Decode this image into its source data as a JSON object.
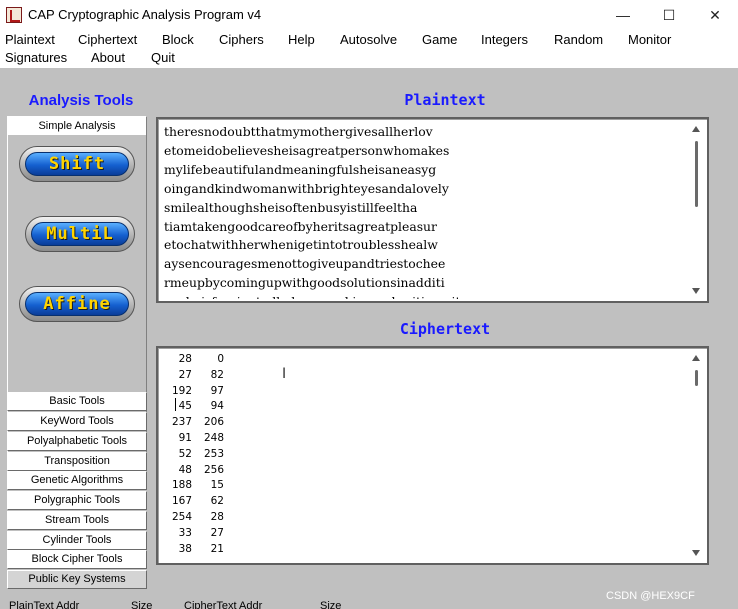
{
  "window": {
    "title": "CAP  Cryptographic Analysis Program v4",
    "minimize_icon": "minimize-icon",
    "maximize_icon": "maximize-icon",
    "close_icon": "close-icon"
  },
  "menu": {
    "items": [
      "Plaintext",
      "Ciphertext",
      "Block",
      "Ciphers",
      "Help",
      "Autosolve",
      "Game",
      "Integers",
      "Random",
      "Monitor",
      "Signatures",
      "About",
      "Quit"
    ]
  },
  "left_panel": {
    "title": "Analysis Tools",
    "simple_tab": "Simple Analysis",
    "buttons": [
      "Shift",
      "MultiL",
      "Affine"
    ],
    "tools": [
      "Basic Tools",
      "KeyWord Tools",
      "Polyalphabetic Tools",
      "Transposition",
      "Genetic Algorithms",
      "Polygraphic Tools",
      "Stream Tools",
      "Cylinder Tools",
      "Block Cipher Tools",
      "Public Key Systems"
    ]
  },
  "plaintext": {
    "title": "Plaintext",
    "lines": [
      "theresnodoubtthatmymothergivesallherlov",
      "etomeidobelievesheisagreatpersonwhomakes",
      "mylifebeautifulandmeaningfulsheisaneasyg",
      "oingandkindwomanwithbrighteyesandalovely",
      "smilealthoughsheisoftenbusyistillfeeltha",
      "tiamtakengoodcareofbyheritsagreatpleasur",
      "etochatwithherwhenigetintotroublesshealw",
      "aysencouragesmenottogiveupandtriestochee",
      "rmeupbycomingupwithgoodsolutionsinadditi",
      "onsheisfascinatedbyhomemakingandwritingwit"
    ]
  },
  "ciphertext": {
    "title": "Ciphertext",
    "rows": [
      [
        "28",
        "0"
      ],
      [
        "27",
        "82"
      ],
      [
        "192",
        "97"
      ],
      [
        "45",
        "94"
      ],
      [
        "237",
        "206"
      ],
      [
        "91",
        "248"
      ],
      [
        "52",
        "253"
      ],
      [
        "48",
        "256"
      ],
      [
        "188",
        "15"
      ],
      [
        "167",
        "62"
      ],
      [
        "254",
        "28"
      ],
      [
        "33",
        "27"
      ],
      [
        "38",
        "21"
      ]
    ],
    "cursor": "I"
  },
  "status": {
    "plaintext_addr": "PlainText Addr",
    "size1": "Size",
    "ciphertext_addr": "CipherText Addr",
    "size2": "Size"
  },
  "watermark": "CSDN @HEX9CF"
}
